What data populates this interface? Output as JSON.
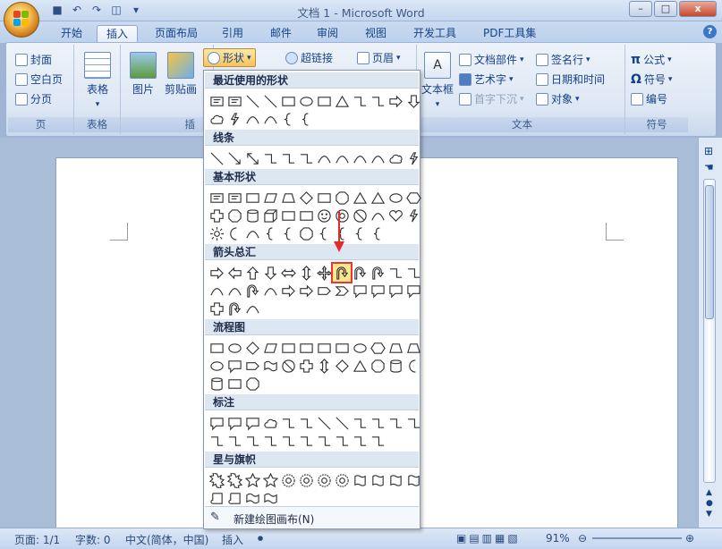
{
  "window": {
    "title": "文档 1 - Microsoft Word",
    "minimize": "–",
    "maximize": "□",
    "close": "x",
    "qat": [
      "save-icon",
      "undo-icon",
      "redo-icon",
      "print-preview-icon",
      "dropdown-icon"
    ]
  },
  "tabs": [
    "开始",
    "插入",
    "页面布局",
    "引用",
    "邮件",
    "审阅",
    "视图",
    "开发工具",
    "PDF工具集"
  ],
  "active_tab": "插入",
  "ribbon": {
    "pages": {
      "items": [
        "封面",
        "空白页",
        "分页"
      ],
      "label": "页"
    },
    "table": {
      "button": "表格",
      "label": "表格"
    },
    "illustrations": {
      "picture": "图片",
      "clipart": "剪贴画",
      "shapes": "形状",
      "label": "插"
    },
    "links": {
      "hyperlink": "超链接"
    },
    "header_footer": {
      "header": "页眉"
    },
    "text": {
      "textbox": "文本框",
      "quickparts": "文档部件",
      "wordart": "艺术字",
      "dropcap": "首字下沉",
      "signature": "签名行",
      "datetime": "日期和时间",
      "object": "对象",
      "label": "文本"
    },
    "symbols": {
      "equation": "公式",
      "symbol": "符号",
      "numbering": "编号",
      "label": "符号"
    }
  },
  "shapes_menu": {
    "sections": [
      "最近使用的形状",
      "线条",
      "基本形状",
      "箭头总汇",
      "流程图",
      "标注",
      "星与旗帜"
    ],
    "footer": "新建绘图画布(N)"
  },
  "status": {
    "page": "页面: 1/1",
    "words": "字数: 0",
    "lang": "中文(简体，中国)",
    "mode": "插入",
    "zoom": "91%"
  },
  "watermark": "Baidu经验"
}
